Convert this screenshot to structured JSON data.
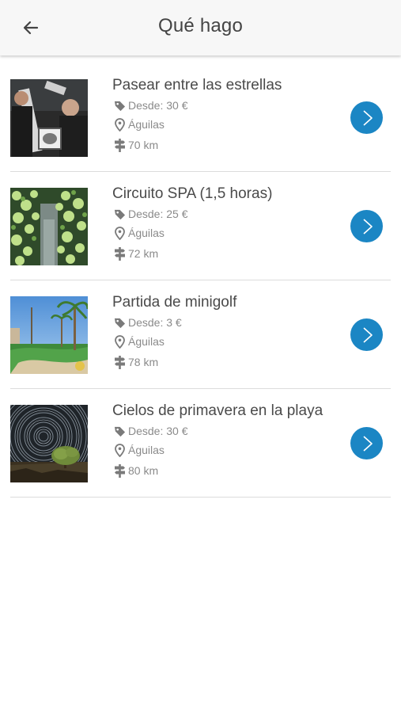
{
  "header": {
    "title": "Qué hago",
    "back_icon": "arrow-left-icon"
  },
  "colors": {
    "accent": "#1b86c4",
    "title_text": "#4a4a4a",
    "meta_text": "#8a8a8a",
    "divider": "#dcdcdc",
    "header_bg": "#f7f7f7"
  },
  "items": [
    {
      "title": "Pasear entre las estrellas",
      "price": "Desde: 30 €",
      "place": "Águilas",
      "distance": "70 km"
    },
    {
      "title": "Circuito SPA (1,5 horas)",
      "price": "Desde: 25 €",
      "place": "Águilas",
      "distance": "72 km"
    },
    {
      "title": "Partida de minigolf",
      "price": "Desde: 3 €",
      "place": "Águilas",
      "distance": "78 km"
    },
    {
      "title": "Cielos de primavera en la playa",
      "price": "Desde: 30 €",
      "place": "Águilas",
      "distance": "80 km"
    }
  ],
  "icons": {
    "price": "price-tag-icon",
    "place": "location-pin-icon",
    "distance": "signpost-icon",
    "go": "chevron-right-icon"
  }
}
